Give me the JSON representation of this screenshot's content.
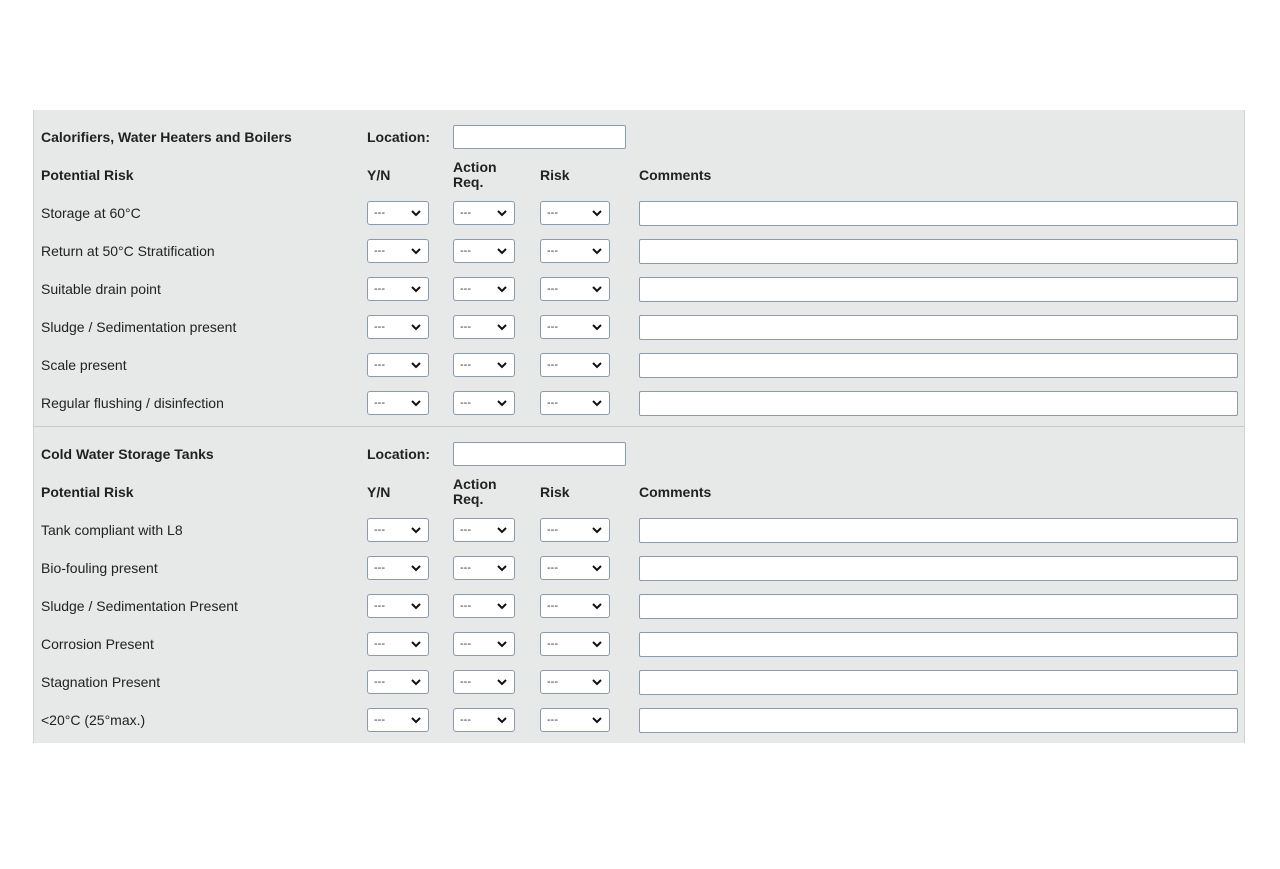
{
  "sections": [
    {
      "title": "Calorifiers, Water Heaters and Boilers",
      "location_label": "Location:",
      "location_value": "",
      "headers": {
        "risk": "Potential Risk",
        "yn": "Y/N",
        "action": "Action Req.",
        "risklevel": "Risk",
        "comments": "Comments"
      },
      "rows": [
        {
          "label": "Storage at 60°C",
          "yn": "---",
          "action": "---",
          "risk": "---",
          "comment": ""
        },
        {
          "label": "Return at 50°C Stratification",
          "yn": "---",
          "action": "---",
          "risk": "---",
          "comment": ""
        },
        {
          "label": "Suitable drain point",
          "yn": "---",
          "action": "---",
          "risk": "---",
          "comment": ""
        },
        {
          "label": "Sludge / Sedimentation present",
          "yn": "---",
          "action": "---",
          "risk": "---",
          "comment": ""
        },
        {
          "label": "Scale present",
          "yn": "---",
          "action": "---",
          "risk": "---",
          "comment": ""
        },
        {
          "label": "Regular flushing / disinfection",
          "yn": "---",
          "action": "---",
          "risk": "---",
          "comment": ""
        }
      ]
    },
    {
      "title": "Cold Water Storage Tanks",
      "location_label": "Location:",
      "location_value": "",
      "headers": {
        "risk": "Potential Risk",
        "yn": "Y/N",
        "action": "Action Req.",
        "risklevel": "Risk",
        "comments": "Comments"
      },
      "rows": [
        {
          "label": "Tank compliant with L8",
          "yn": "---",
          "action": "---",
          "risk": "---",
          "comment": ""
        },
        {
          "label": "Bio-fouling present",
          "yn": "---",
          "action": "---",
          "risk": "---",
          "comment": ""
        },
        {
          "label": "Sludge / Sedimentation Present",
          "yn": "---",
          "action": "---",
          "risk": "---",
          "comment": ""
        },
        {
          "label": "Corrosion Present",
          "yn": "---",
          "action": "---",
          "risk": "---",
          "comment": ""
        },
        {
          "label": "Stagnation Present",
          "yn": "---",
          "action": "---",
          "risk": "---",
          "comment": ""
        },
        {
          "label": "<20°C (25°max.)",
          "yn": "---",
          "action": "---",
          "risk": "---",
          "comment": ""
        }
      ]
    }
  ],
  "icons": {
    "dropdown": "chevron-down-icon"
  },
  "colors": {
    "panel": "#e7e8e8",
    "border": "#8a9bb0"
  }
}
